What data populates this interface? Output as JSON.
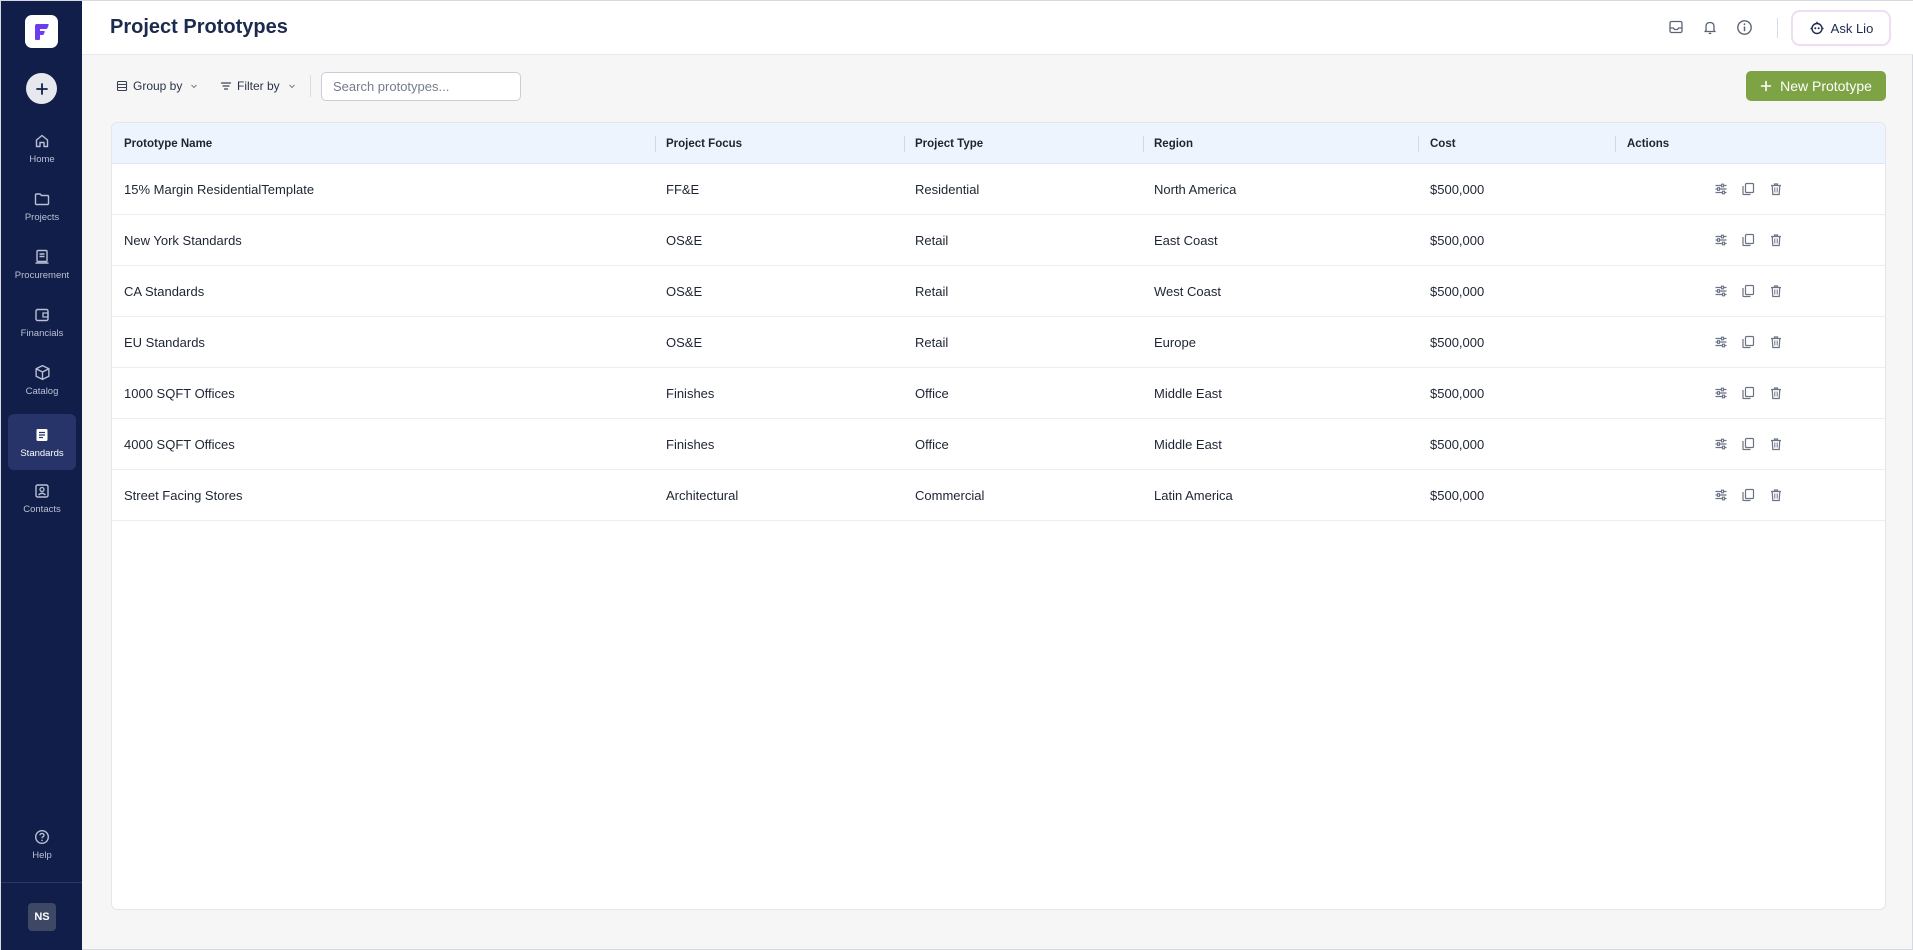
{
  "app": {
    "page_title": "Project Prototypes"
  },
  "sidebar": {
    "items": [
      {
        "label": "Home",
        "icon": "home-icon"
      },
      {
        "label": "Projects",
        "icon": "folder-icon"
      },
      {
        "label": "Procurement",
        "icon": "receipt-icon"
      },
      {
        "label": "Financials",
        "icon": "wallet-icon"
      },
      {
        "label": "Catalog",
        "icon": "cube-icon"
      },
      {
        "label": "Standards",
        "icon": "document-icon",
        "active": true
      },
      {
        "label": "Contacts",
        "icon": "contact-card-icon"
      }
    ],
    "help_label": "Help",
    "avatar_initials": "NS"
  },
  "topbar": {
    "ask_label": "Ask Lio"
  },
  "toolbar": {
    "group_by_label": "Group by",
    "filter_by_label": "Filter by",
    "search_placeholder": "Search prototypes...",
    "new_button_label": "New Prototype"
  },
  "table": {
    "columns": [
      "Prototype Name",
      "Project Focus",
      "Project Type",
      "Region",
      "Cost",
      "Actions"
    ],
    "rows": [
      {
        "name": "15% Margin ResidentialTemplate",
        "focus": "FF&E",
        "type": "Residential",
        "region": "North America",
        "cost": "$500,000"
      },
      {
        "name": "New York Standards",
        "focus": "OS&E",
        "type": "Retail",
        "region": "East Coast",
        "cost": "$500,000"
      },
      {
        "name": "CA Standards",
        "focus": "OS&E",
        "type": "Retail",
        "region": "West Coast",
        "cost": "$500,000"
      },
      {
        "name": "EU Standards",
        "focus": "OS&E",
        "type": "Retail",
        "region": "Europe",
        "cost": "$500,000"
      },
      {
        "name": "1000 SQFT Offices",
        "focus": "Finishes",
        "type": "Office",
        "region": "Middle East",
        "cost": "$500,000"
      },
      {
        "name": "4000 SQFT Offices",
        "focus": "Finishes",
        "type": "Office",
        "region": "Middle East",
        "cost": "$500,000"
      },
      {
        "name": "Street Facing Stores",
        "focus": "Architectural",
        "type": "Commercial",
        "region": "Latin America",
        "cost": "$500,000"
      }
    ]
  },
  "colors": {
    "sidebar_bg": "#121e4a",
    "accent_green": "#7ea344",
    "header_bg": "#eef4fd",
    "logo_accent": "#6a3df0"
  }
}
